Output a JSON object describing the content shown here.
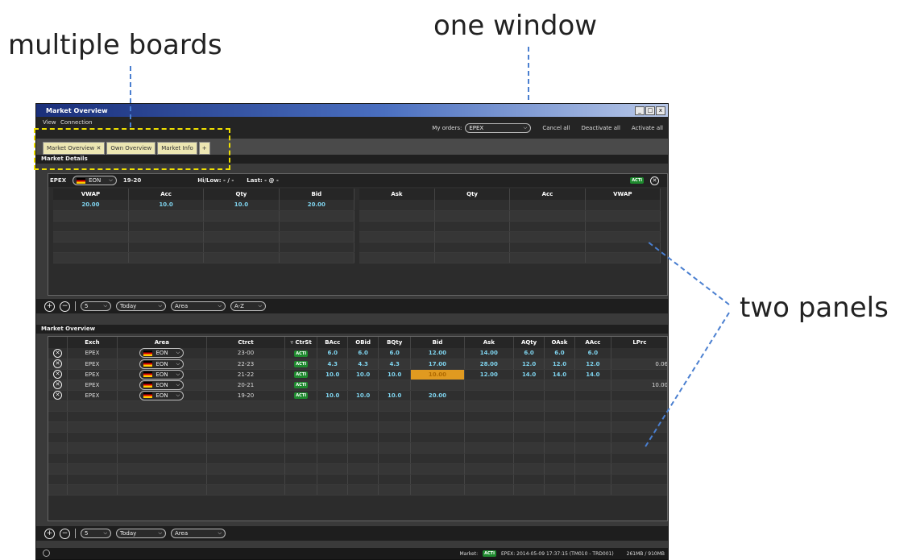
{
  "annotations": {
    "multiple_boards": "multiple boards",
    "one_window": "one window",
    "two_panels": "two panels"
  },
  "window": {
    "title": "Market Overview",
    "controls": [
      "_",
      "□",
      "x"
    ]
  },
  "menu": {
    "view": "View",
    "connection": "Connection"
  },
  "orders": {
    "label": "My orders:",
    "selected": "EPEX",
    "cancel_all": "Cancel all",
    "deactivate_all": "Deactivate all",
    "activate_all": "Activate all"
  },
  "tabs": [
    {
      "label": "Market Overview ✕"
    },
    {
      "label": "Own Overview"
    },
    {
      "label": "Market Info"
    },
    {
      "label": "+"
    }
  ],
  "market_details": {
    "section_label": "Market Details",
    "exchange": "EPEX",
    "area": "EON",
    "contract": "19-20",
    "hilow": "Hi/Low:  - / -",
    "last": "Last:  - @ -",
    "badge": "ACTI",
    "headers_bid": [
      "VWAP",
      "Acc",
      "Qty",
      "Bid"
    ],
    "headers_ask": [
      "Ask",
      "Qty",
      "Acc",
      "VWAP"
    ],
    "row1": [
      "20.00",
      "10.0",
      "10.0",
      "20.00"
    ],
    "controls": {
      "depth": "5",
      "day": "Today",
      "area": "Area",
      "sort": "A-Z"
    }
  },
  "overview": {
    "section_label": "Market Overview",
    "headers": [
      "",
      "Exch",
      "Area",
      "Ctrct",
      "▿ CtrSt",
      "BAcc",
      "OBid",
      "BQty",
      "Bid",
      "Ask",
      "AQty",
      "OAsk",
      "AAcc",
      "LPrc"
    ],
    "rows": [
      {
        "exch": "EPEX",
        "area": "EON",
        "ctrct": "23-00",
        "status": "ACTI",
        "bacc": "6.0",
        "obid": "6.0",
        "bqty": "6.0",
        "bid": "12.00",
        "ask": "14.00",
        "aqty": "6.0",
        "oask": "6.0",
        "aacc": "6.0",
        "lprc": ""
      },
      {
        "exch": "EPEX",
        "area": "EON",
        "ctrct": "22-23",
        "status": "ACTI",
        "bacc": "4.3",
        "obid": "4.3",
        "bqty": "4.3",
        "bid": "17.00",
        "ask": "28.00",
        "aqty": "12.0",
        "oask": "12.0",
        "aacc": "12.0",
        "lprc": "0.06"
      },
      {
        "exch": "EPEX",
        "area": "EON",
        "ctrct": "21-22",
        "status": "ACTI",
        "bacc": "10.0",
        "obid": "10.0",
        "bqty": "10.0",
        "bid": "10.00",
        "ask": "12.00",
        "aqty": "14.0",
        "oask": "14.0",
        "aacc": "14.0",
        "lprc": ""
      },
      {
        "exch": "EPEX",
        "area": "EON",
        "ctrct": "20-21",
        "status": "ACTI",
        "bacc": "",
        "obid": "",
        "bqty": "",
        "bid": "",
        "ask": "",
        "aqty": "",
        "oask": "",
        "aacc": "",
        "lprc": "10.00"
      },
      {
        "exch": "EPEX",
        "area": "EON",
        "ctrct": "19-20",
        "status": "ACTI",
        "bacc": "10.0",
        "obid": "10.0",
        "bqty": "10.0",
        "bid": "20.00",
        "ask": "",
        "aqty": "",
        "oask": "",
        "aacc": "",
        "lprc": ""
      }
    ],
    "controls": {
      "depth": "5",
      "day": "Today",
      "area": "Area"
    }
  },
  "status": {
    "market_label": "Market:",
    "badge": "ACTI",
    "info": "EPEX: 2014-05-09 17:37:15 (TM010 - TRD001)",
    "memory": "261MB / 910MB"
  }
}
